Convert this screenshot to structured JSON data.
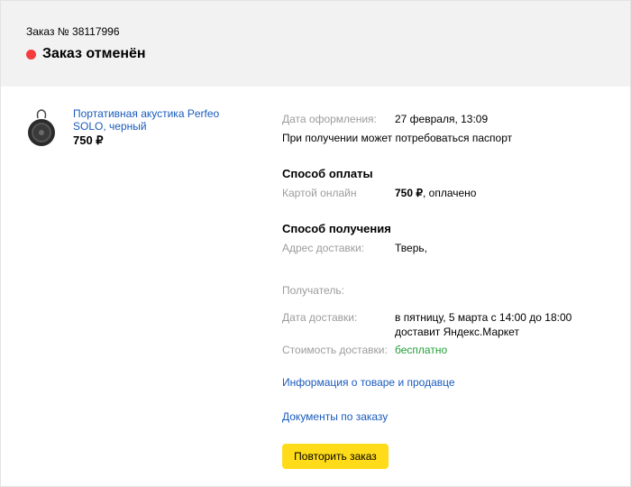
{
  "header": {
    "order_number": "Заказ № 38117996",
    "status_text": "Заказ отменён",
    "status_color": "#f43c3c"
  },
  "product": {
    "name": "Портативная акустика Perfeo SOLO, черный",
    "price": "750 ₽",
    "image_icon": "portable-speaker-icon"
  },
  "details": {
    "order_date_label": "Дата оформления:",
    "order_date_value": "27 февраля, 13:09",
    "passport_note": "При получении может потребоваться паспорт",
    "payment_title": "Способ оплаты",
    "payment_method_label": "Картой онлайн",
    "payment_amount": "750 ₽",
    "payment_status": ", оплачено",
    "delivery_title": "Способ получения",
    "address_label": "Адрес доставки:",
    "address_value": "Тверь,",
    "recipient_label": "Получатель:",
    "delivery_date_label": "Дата доставки:",
    "delivery_date_value": "в пятницу, 5 марта с 14:00 до 18:00 доставит Яндекс.Маркет",
    "delivery_cost_label": "Стоимость доставки:",
    "delivery_cost_value": "бесплатно"
  },
  "links": {
    "product_info": "Информация о товаре и продавце",
    "documents": "Документы по заказу"
  },
  "actions": {
    "repeat_order": "Повторить заказ"
  },
  "colors": {
    "accent_button": "#ffdb1a",
    "link": "#1a5bbd",
    "free": "#21a038"
  }
}
